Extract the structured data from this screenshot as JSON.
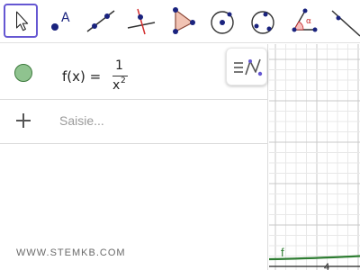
{
  "toolbar": {
    "tools": [
      {
        "name": "Move",
        "icon": "cursor-arrow-icon",
        "active": true
      },
      {
        "name": "Point",
        "icon": "point-icon",
        "active": false
      },
      {
        "name": "Line",
        "icon": "line-icon",
        "active": false
      },
      {
        "name": "Perpendicular Line",
        "icon": "perpendicular-line-icon",
        "active": false
      },
      {
        "name": "Polygon",
        "icon": "polygon-icon",
        "active": false
      },
      {
        "name": "Circle with Center through Point",
        "icon": "circle-center-point-icon",
        "active": false
      },
      {
        "name": "Circle through 3 Points",
        "icon": "circle-three-points-icon",
        "active": false
      },
      {
        "name": "Angle",
        "icon": "angle-icon",
        "active": false
      },
      {
        "name": "Reflect about Line",
        "icon": "reflect-line-icon",
        "active": false
      }
    ],
    "point_label": "A",
    "angle_label": "α"
  },
  "algebra": {
    "function": {
      "lhs": "f(x) =",
      "numerator": "1",
      "denominator_base": "x",
      "denominator_exp": "2",
      "color": "#8fc38f"
    },
    "input_placeholder": "Saisie..."
  },
  "watermark": "WWW.STEMKB.COM",
  "graphics": {
    "curve_label": "f",
    "x_tick_label": "4",
    "curve_color": "#2e7d32"
  },
  "colors": {
    "accent": "#6557d2",
    "point": "#1a237e",
    "polygon_fill": "#f1c3b3",
    "angle_fill": "#f6c0c0"
  }
}
